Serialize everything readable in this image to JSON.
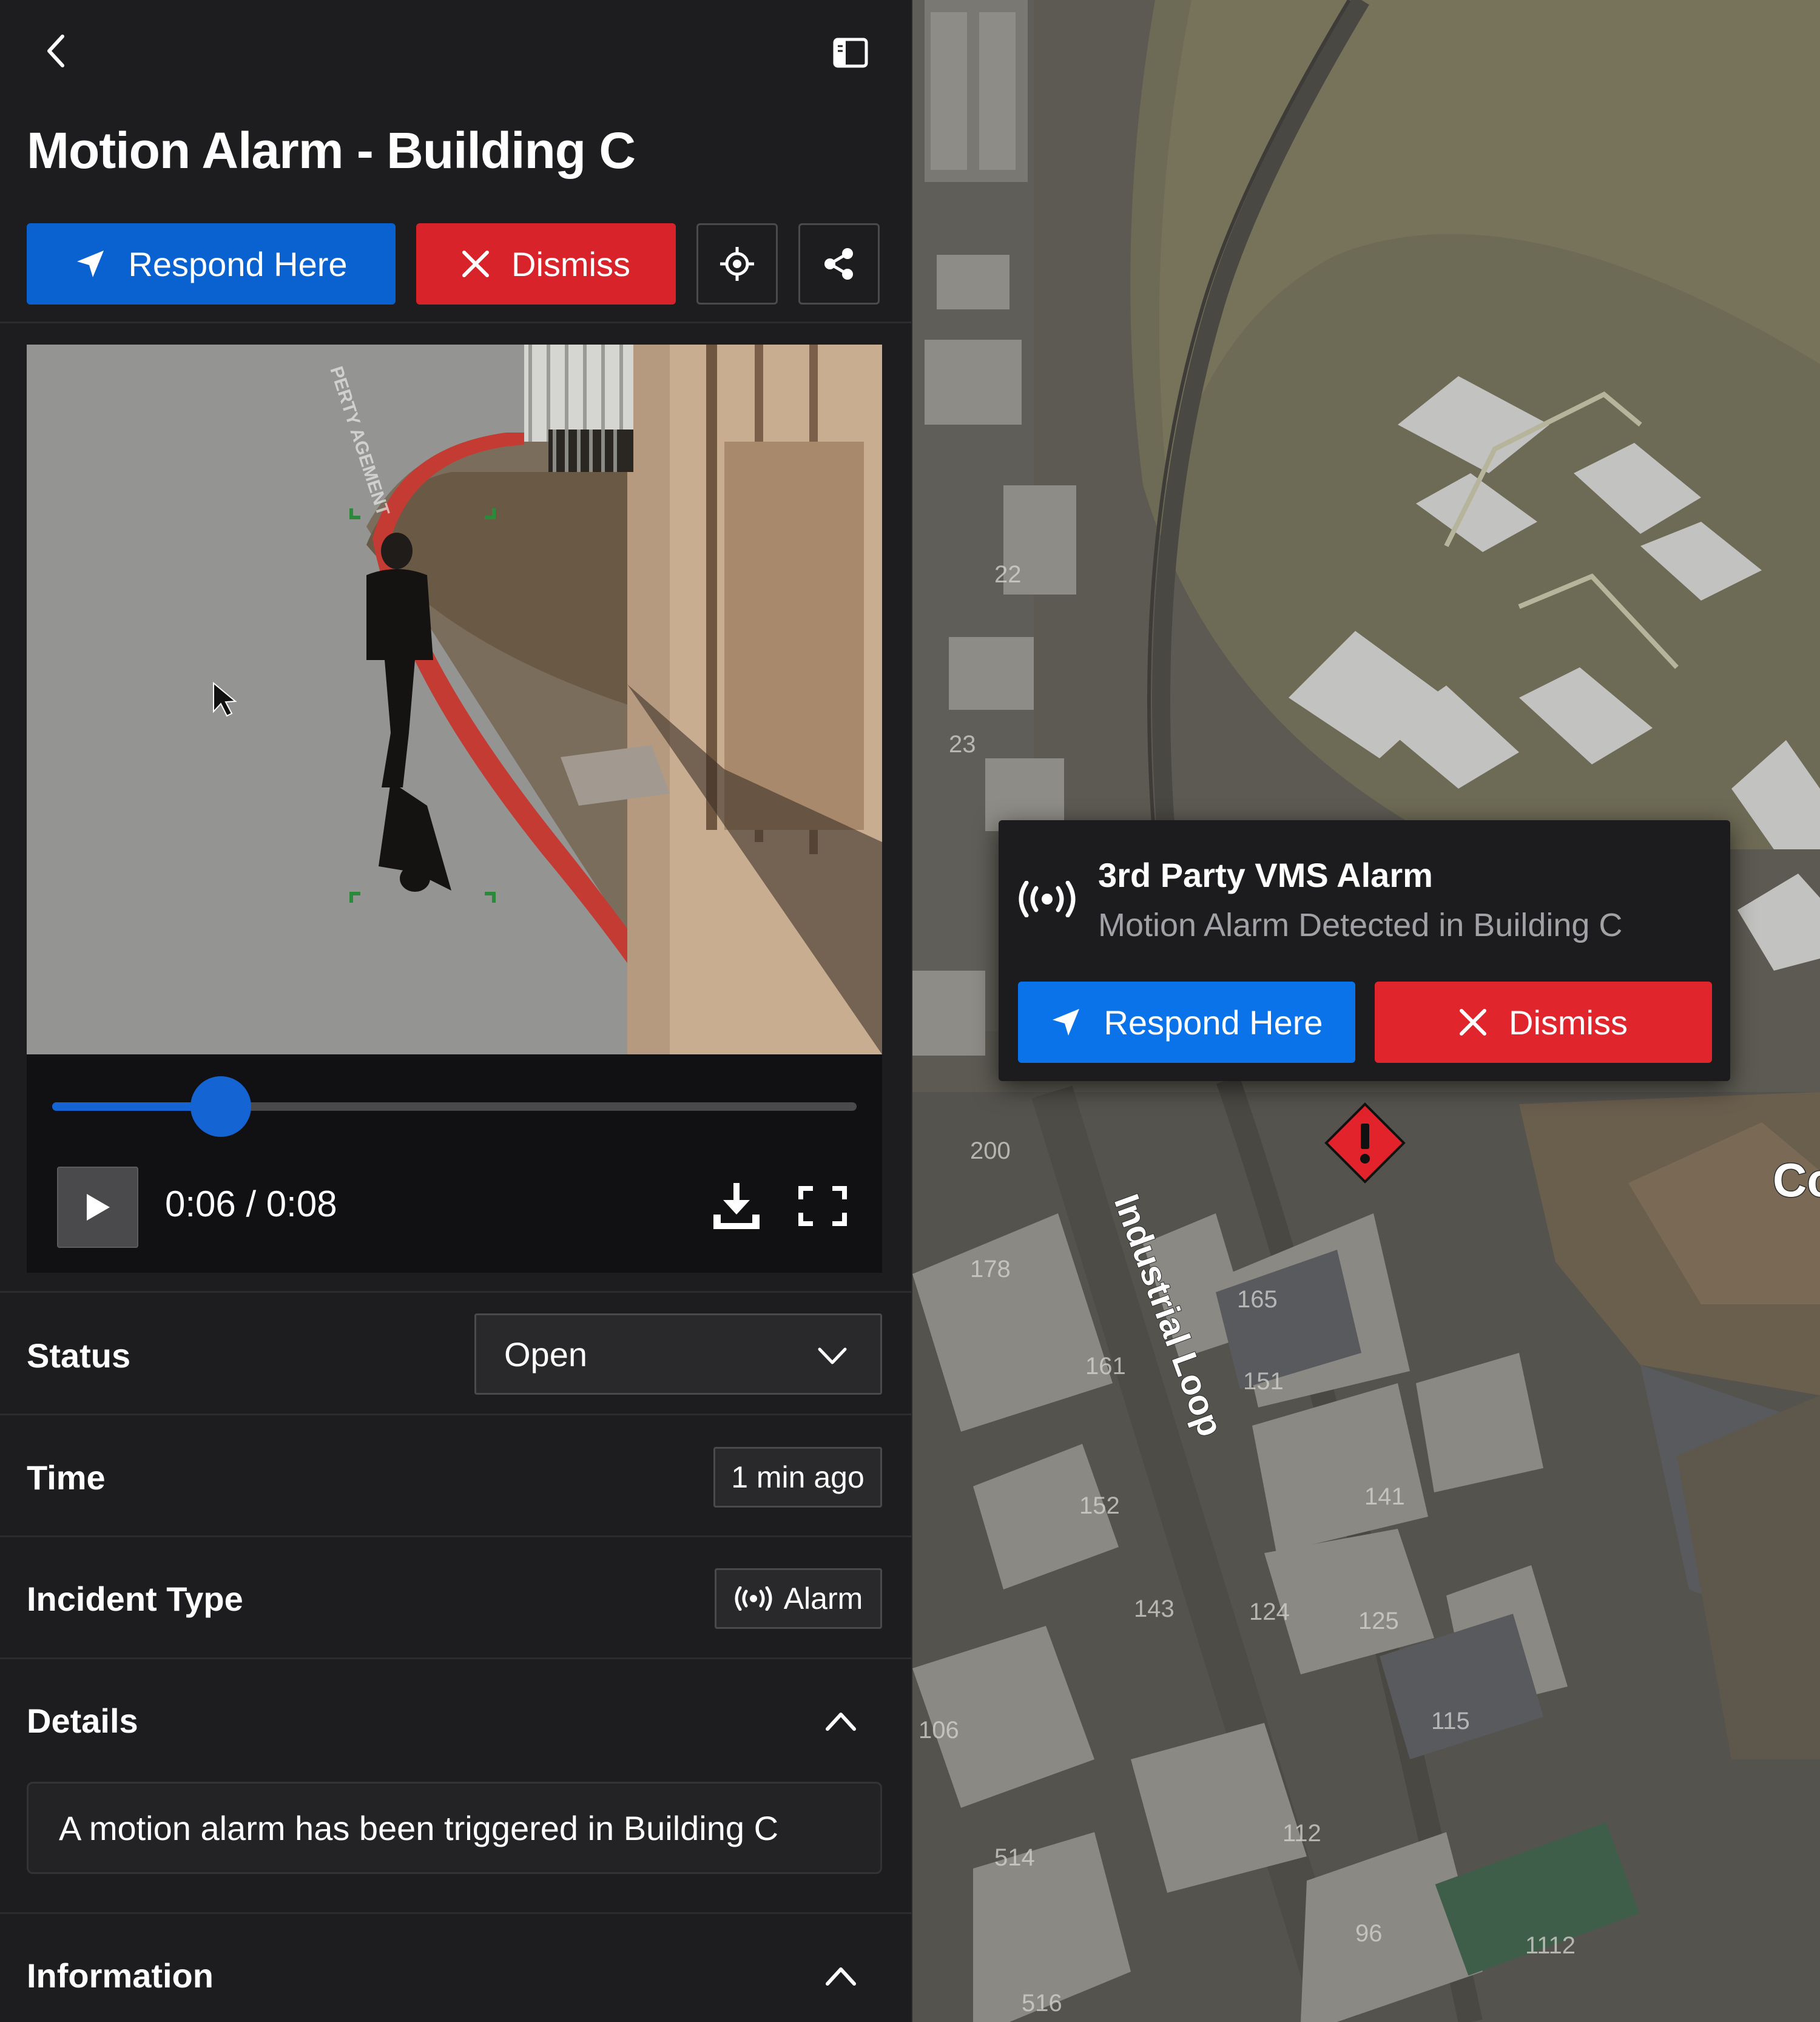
{
  "header": {
    "back_icon": "chevron-left-icon",
    "sidebar_toggle_icon": "sidebar-toggle-icon",
    "title": "Motion Alarm - Building C"
  },
  "actions": {
    "respond_label": "Respond Here",
    "dismiss_label": "Dismiss",
    "locate_icon": "crosshair-icon",
    "share_icon": "share-icon",
    "respond_color": "#0a62d1",
    "dismiss_color": "#d8232a"
  },
  "video": {
    "current_time": "0:06",
    "duration": "0:08",
    "time_display": "0:06 / 0:08",
    "progress": 0.21,
    "watermark": "PERTY AGEMENT"
  },
  "fields": {
    "status_label": "Status",
    "status_value": "Open",
    "time_label": "Time",
    "time_value": "1 min ago",
    "incident_type_label": "Incident Type",
    "incident_type_value": "Alarm",
    "details_label": "Details",
    "details_text": "A motion alarm has been triggered in Building C",
    "information_label": "Information"
  },
  "map": {
    "street_label": "Industrial Loop",
    "building_numbers": [
      "200",
      "178",
      "165",
      "151",
      "161",
      "152",
      "141",
      "125",
      "143",
      "124",
      "115",
      "112",
      "106",
      "514",
      "96",
      "516",
      "1112",
      "22",
      "23"
    ],
    "edge_label": "Co",
    "alarm_marker_icon": "alarm-warning-icon",
    "popup": {
      "title": "3rd Party VMS Alarm",
      "subtitle": "Motion Alarm Detected in Building C",
      "respond_label": "Respond Here",
      "dismiss_label": "Dismiss",
      "icon": "broadcast-icon",
      "respond_color": "#0a73ea",
      "dismiss_color": "#e0252c"
    }
  }
}
